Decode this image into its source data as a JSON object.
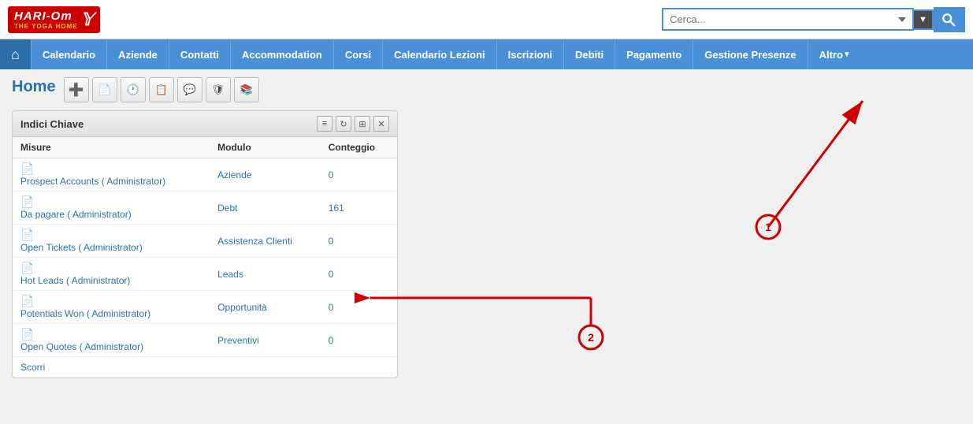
{
  "logo": {
    "text": "HARI-Om",
    "subtitle": "THE YOGA HOME"
  },
  "search": {
    "placeholder": "Cerca...",
    "dropdown_arrow": "▼"
  },
  "nav": {
    "home_icon": "⌂",
    "items": [
      {
        "label": "Calendario",
        "arrow": false
      },
      {
        "label": "Aziende",
        "arrow": false
      },
      {
        "label": "Contatti",
        "arrow": false
      },
      {
        "label": "Accommodation",
        "arrow": false
      },
      {
        "label": "Corsi",
        "arrow": false
      },
      {
        "label": "Calendario Lezioni",
        "arrow": false
      },
      {
        "label": "Iscrizioni",
        "arrow": false
      },
      {
        "label": "Debiti",
        "arrow": false
      },
      {
        "label": "Pagamento",
        "arrow": false
      },
      {
        "label": "Gestione Presenze",
        "arrow": false
      },
      {
        "label": "Altro",
        "arrow": true
      }
    ]
  },
  "page": {
    "title": "Home"
  },
  "toolbar": {
    "buttons": [
      {
        "icon": "➕",
        "name": "add-button"
      },
      {
        "icon": "📄",
        "name": "document-button"
      },
      {
        "icon": "🕐",
        "name": "clock-button"
      },
      {
        "icon": "📋",
        "name": "clipboard-button"
      },
      {
        "icon": "💬",
        "name": "chat-button"
      },
      {
        "icon": "🛡",
        "name": "shield-button"
      },
      {
        "icon": "📚",
        "name": "books-button"
      }
    ]
  },
  "widget": {
    "title": "Indici Chiave",
    "controls": [
      "≡",
      "↻",
      "⊞",
      "✕"
    ],
    "table": {
      "headers": [
        "Misure",
        "Modulo",
        "Conteggio"
      ],
      "rows": [
        {
          "measure": "Prospect Accounts ( Administrator)",
          "module": "Aziende",
          "count": "0"
        },
        {
          "measure": "Da pagare ( Administrator)",
          "module": "Debt",
          "count": "161"
        },
        {
          "measure": "Open Tickets ( Administrator)",
          "module": "Assistenza Clienti",
          "count": "0"
        },
        {
          "measure": "Hot Leads ( Administrator)",
          "module": "Leads",
          "count": "0"
        },
        {
          "measure": "Potentials Won ( Administrator)",
          "module": "Opportunità",
          "count": "0"
        },
        {
          "measure": "Open Quotes ( Administrator)",
          "module": "Preventivi",
          "count": "0"
        }
      ]
    },
    "scroll_link": "Scorri"
  },
  "annotations": {
    "arrow1_num": "1",
    "arrow2_num": "2"
  }
}
